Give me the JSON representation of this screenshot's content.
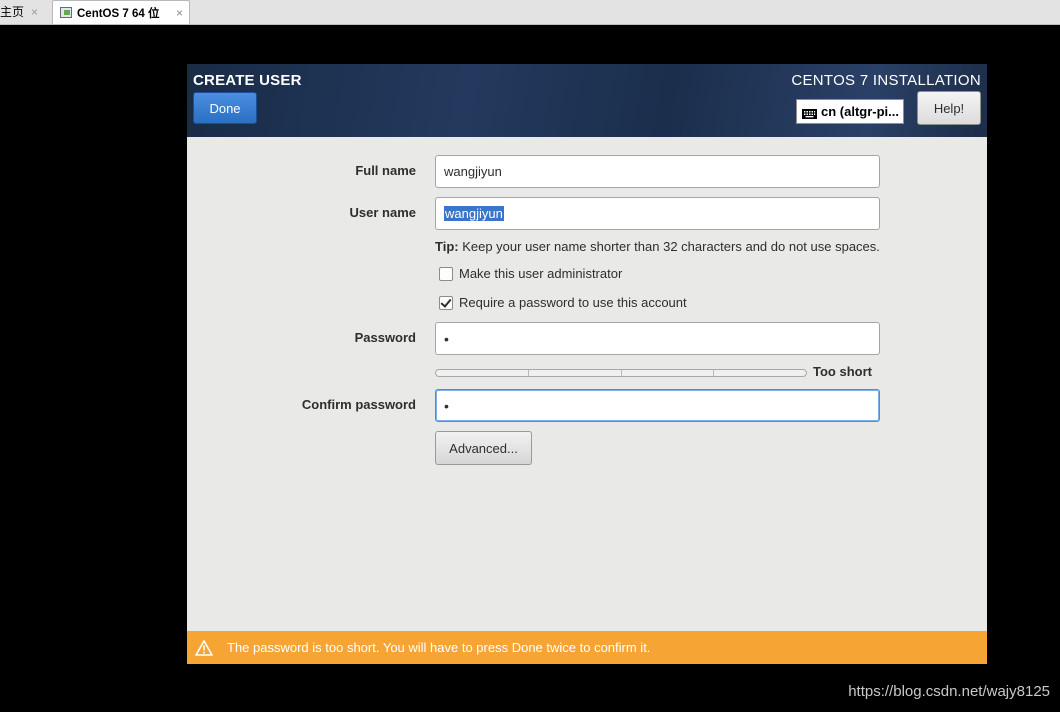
{
  "host": {
    "tabs": [
      {
        "label": "主页",
        "close": "×"
      },
      {
        "label": "CentOS 7 64 位",
        "close": "×"
      }
    ]
  },
  "installer": {
    "page_title": "CREATE USER",
    "product_title": "CENTOS 7 INSTALLATION",
    "done_label": "Done",
    "keyboard_layout": "cn (altgr-pi...",
    "help_label": "Help!"
  },
  "form": {
    "full_name_label": "Full name",
    "full_name_value": "wangjiyun",
    "user_name_label": "User name",
    "user_name_value": "wangjiyun",
    "tip_prefix": "Tip:",
    "tip_text": " Keep your user name shorter than 32 characters and do not use spaces.",
    "admin_label": "Make this user administrator",
    "admin_checked": false,
    "require_password_label": "Require a password to use this account",
    "require_password_checked": true,
    "password_label": "Password",
    "password_value": "•",
    "strength_label": "Too short",
    "strength_level": 0,
    "confirm_label": "Confirm password",
    "confirm_value": "•",
    "advanced_label": "Advanced..."
  },
  "warning": {
    "text": "The password is too short. You will have to press Done twice to confirm it.",
    "icon": "warning-icon",
    "color": "#f6a535"
  },
  "watermark": "https://blog.csdn.net/wajy8125"
}
